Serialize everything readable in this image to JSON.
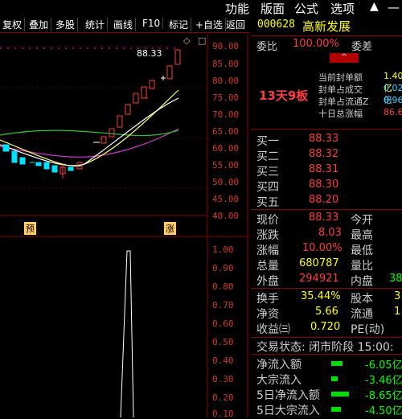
{
  "menu": [
    "功能",
    "版面",
    "公式",
    "选项"
  ],
  "toolbar": [
    "复权",
    "叠加",
    "多股",
    "统计",
    "画线",
    "F10",
    "标记",
    "+自选",
    "返回"
  ],
  "chart": {
    "price_axis": [
      "90.00",
      "85.00",
      "80.00",
      "75.00",
      "70.00",
      "65.00",
      "60.00",
      "55.00",
      "50.00",
      "45.00",
      "40.00",
      "35.00"
    ],
    "vol_axis": [
      "1.00",
      "0.90",
      "0.80",
      "0.70",
      "0.60",
      "0.50",
      "0.40",
      "0.30",
      "0.20",
      "0.10"
    ],
    "high_label": "88.33",
    "markers": [
      "预",
      "涨"
    ]
  },
  "panel": {
    "code": "000628",
    "name": "高新发展",
    "weibi_label": "委比",
    "weibi_value": "100.00%",
    "weicha_label": "委差",
    "streak": "13天9板",
    "seal_rows": [
      {
        "label": "当前封单额",
        "value": "1.40亿"
      },
      {
        "label": "封单占成交",
        "value": "0.02倍"
      },
      {
        "label": "封单占流通Z",
        "value": "0.96%"
      },
      {
        "label": "十日总涨幅",
        "value": "86.67%"
      }
    ],
    "bids": [
      {
        "label": "买一",
        "price": "88.33"
      },
      {
        "label": "买二",
        "price": "88.32"
      },
      {
        "label": "买三",
        "price": "88.31"
      },
      {
        "label": "买四",
        "price": "88.30"
      },
      {
        "label": "买五",
        "price": "88.20"
      }
    ],
    "quote": [
      {
        "l1": "现价",
        "v1": "88.33",
        "l2": "今开",
        "v2": ""
      },
      {
        "l1": "涨跌",
        "v1": "8.03",
        "l2": "最高",
        "v2": ""
      },
      {
        "l1": "涨幅",
        "v1": "10.00%",
        "l2": "最低",
        "v2": ""
      },
      {
        "l1": "总量",
        "v1": "680787",
        "l2": "量比",
        "v2": ""
      },
      {
        "l1": "外盘",
        "v1": "294921",
        "l2": "内盘",
        "v2": "38"
      }
    ],
    "stats": [
      {
        "l1": "换手",
        "v1": "35.44%",
        "l2": "股本",
        "v2": "3"
      },
      {
        "l1": "净资",
        "v1": "5.66",
        "l2": "流通",
        "v2": "1"
      },
      {
        "l1": "收益㈢",
        "v1": "0.720",
        "l2": "PE(动)",
        "v2": ""
      }
    ],
    "trade_status": "交易状态: 闭市阶段 15:00:",
    "flows": [
      {
        "label": "净流入额",
        "value": "-6.05亿",
        "bar": 0.35
      },
      {
        "label": "大宗流入",
        "value": "-3.46亿",
        "bar": 0.2
      },
      {
        "label": "5日净流入额",
        "value": "-8.65亿",
        "bar": 0.5
      },
      {
        "label": "5日大宗流入",
        "value": "-4.50亿",
        "bar": 0.26
      }
    ],
    "colors": {
      "accent": "#ff3b3b",
      "up": "#ff3b3b",
      "down": "#00ff00",
      "label": "#ffff00"
    }
  }
}
